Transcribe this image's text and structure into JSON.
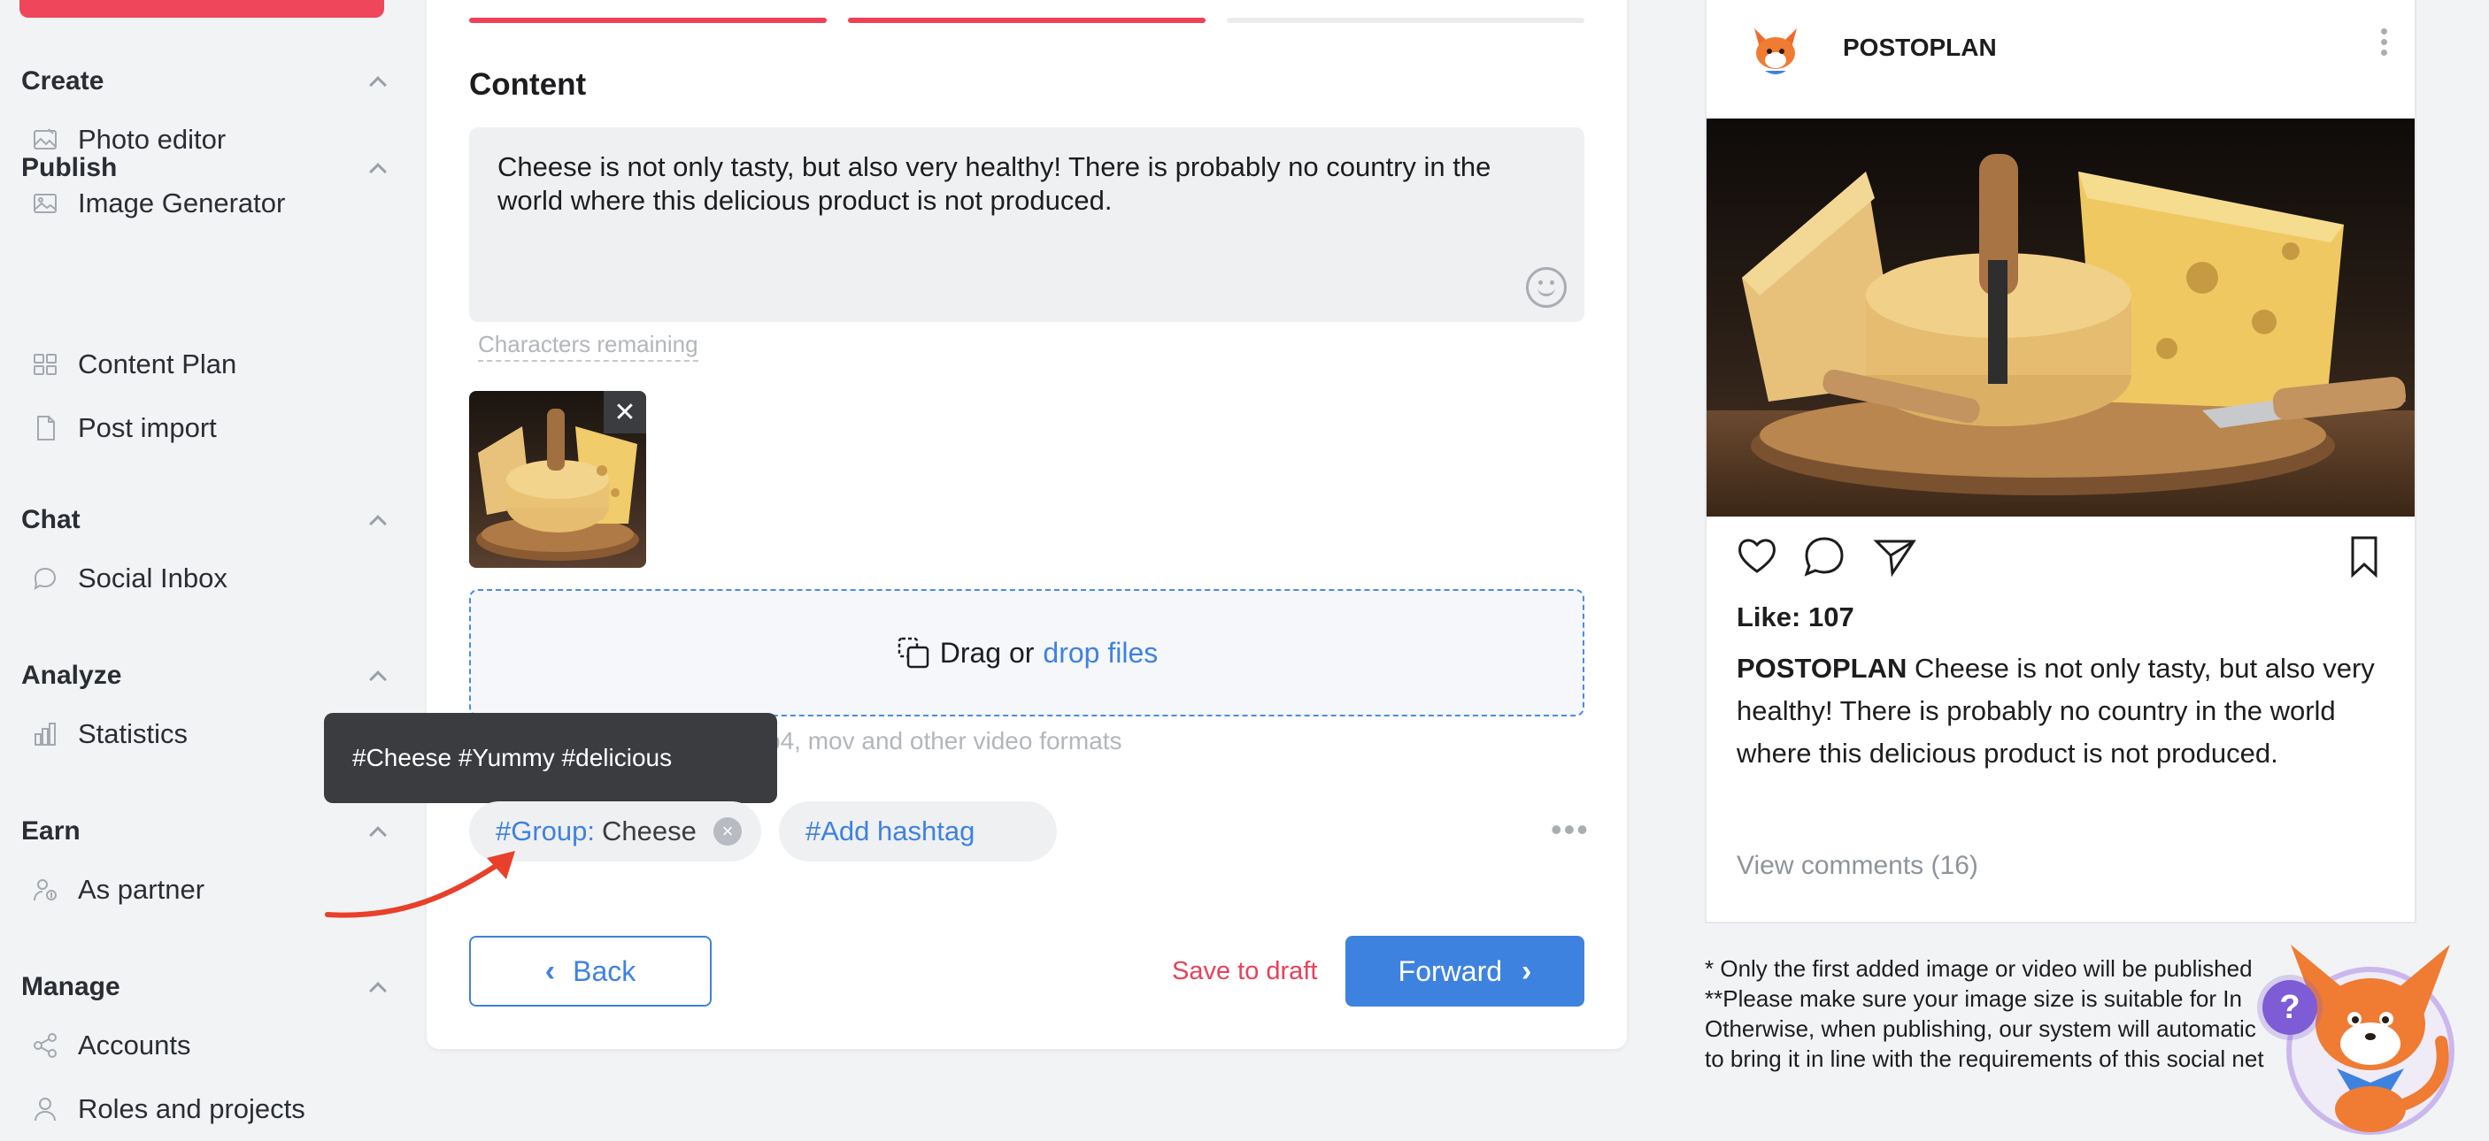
{
  "colors": {
    "accent": "#3e82e0",
    "brand_red": "#ec4157",
    "tooltip_bg": "#3a3c40",
    "help_purple": "#7d5cd6"
  },
  "sidebar": {
    "groups": [
      {
        "label": "Create",
        "items": [
          {
            "label": "Photo editor",
            "icon": "photo-editor-icon"
          },
          {
            "label": "Image Generator",
            "icon": "image-icon"
          }
        ]
      },
      {
        "label": "Publish",
        "items": [
          {
            "label": "Content Plan",
            "icon": "grid-icon"
          },
          {
            "label": "Post import",
            "icon": "csv-file-icon"
          }
        ]
      },
      {
        "label": "Chat",
        "items": [
          {
            "label": "Social Inbox",
            "icon": "chat-bubble-icon"
          }
        ]
      },
      {
        "label": "Analyze",
        "items": [
          {
            "label": "Statistics",
            "icon": "bar-chart-icon"
          }
        ]
      },
      {
        "label": "Earn",
        "items": [
          {
            "label": "As partner",
            "icon": "partner-icon"
          }
        ]
      },
      {
        "label": "Manage",
        "items": [
          {
            "label": "Accounts",
            "icon": "share-icon"
          },
          {
            "label": "Roles and projects",
            "icon": "users-icon"
          }
        ]
      }
    ]
  },
  "editor": {
    "progress_steps": [
      {
        "active": true
      },
      {
        "active": true
      },
      {
        "active": false
      }
    ],
    "content_title": "Content",
    "text": "Cheese is not only tasty, but also very healthy!  There is probably no country in the world  where this delicious product is not produced.",
    "characters_remaining": "Characters remaining",
    "thumb_close": "✕",
    "dropzone": {
      "text": "Drag or",
      "link": "drop files"
    },
    "formats_hint": "p4, mov and other video formats",
    "tooltip": "#Cheese #Yummy #delicious",
    "hashtag_group": {
      "key": "#Group:",
      "value": "Cheese"
    },
    "add_hashtag": "#Add hashtag",
    "back_label": "Back",
    "save_draft_label": "Save to draft",
    "forward_label": "Forward"
  },
  "preview": {
    "account_name": "POSTOPLAN",
    "likes": "Like: 107",
    "caption_name": "POSTOPLAN",
    "caption_text": "Cheese is not only tasty, but also very healthy!  There is probably no country in the world  where this delicious product is not produced.",
    "comments": "View comments (16)",
    "note_1": "* Only the first added image or video will be published",
    "note_2": "**Please make sure your image size is suitable for In",
    "note_3": "Otherwise, when publishing, our system will automatic",
    "note_4": "to bring it in line with the requirements of this social net",
    "help_label": "?"
  }
}
